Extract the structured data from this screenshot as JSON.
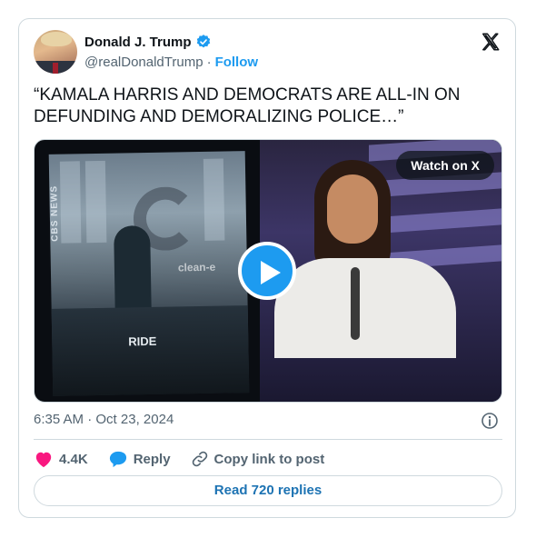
{
  "author": {
    "display_name": "Donald J. Trump",
    "handle": "@realDonaldTrump",
    "separator": "·",
    "follow_label": "Follow"
  },
  "tweet": {
    "text": "“KAMALA HARRIS AND DEMOCRATS ARE ALL-IN ON DEFUNDING AND DEMORALIZING POLICE…”",
    "time": "6:35 AM",
    "date_separator": "·",
    "date": "Oct 23, 2024"
  },
  "media": {
    "watch_label": "Watch on X",
    "left_frame_vertical_text": "CBS NEWS",
    "left_frame_sign_text": "clean-e",
    "left_frame_jacket_text": "RIDE"
  },
  "actions": {
    "likes": "4.4K",
    "reply_label": "Reply",
    "copy_label": "Copy link to post"
  },
  "replies_button": "Read 720 replies",
  "colors": {
    "accent": "#1d9bf0",
    "like_heart": "#f91880",
    "text_secondary": "#536471",
    "border": "#cfd9de"
  },
  "icons": [
    "verified-badge-icon",
    "x-logo-icon",
    "play-icon",
    "info-icon",
    "heart-icon",
    "reply-bubble-icon",
    "link-icon"
  ]
}
